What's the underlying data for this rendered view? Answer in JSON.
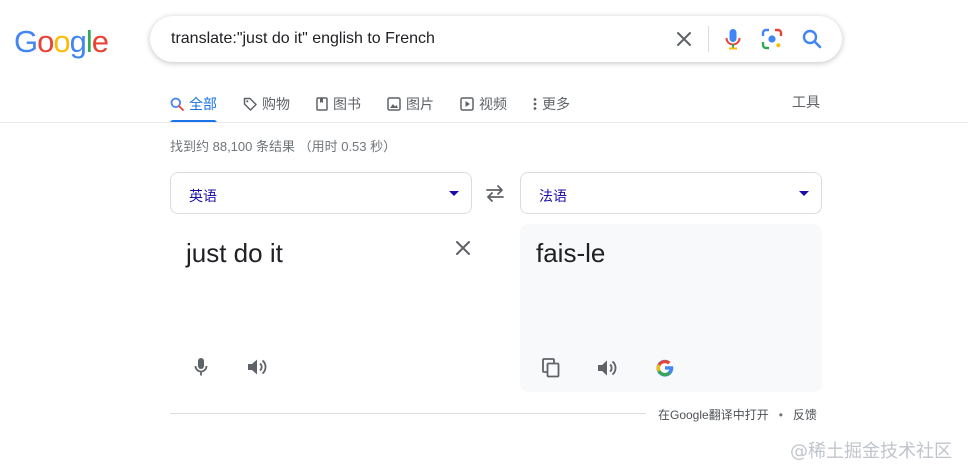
{
  "logo": {
    "letters": [
      "G",
      "o",
      "o",
      "g",
      "l",
      "e"
    ],
    "colors": [
      "#4285f4",
      "#ea4335",
      "#fbbc05",
      "#4285f4",
      "#34a853",
      "#ea4335"
    ]
  },
  "search": {
    "query": "translate:\"just do it\" english to French"
  },
  "tabs": [
    {
      "label": "全部",
      "icon": "search-icon",
      "active": true
    },
    {
      "label": "购物",
      "icon": "tag-icon"
    },
    {
      "label": "图书",
      "icon": "book-icon"
    },
    {
      "label": "图片",
      "icon": "image-icon"
    },
    {
      "label": "视频",
      "icon": "play-icon"
    },
    {
      "label": "更多",
      "icon": "more-vert-icon"
    }
  ],
  "tools_label": "工具",
  "result_stats": "找到约 88,100 条结果 （用时 0.53 秒）",
  "translate": {
    "source_lang": "英语",
    "target_lang": "法语",
    "source_text": "just do it",
    "target_text": "fais-le"
  },
  "footer": {
    "open_link": "在Google翻译中打开",
    "feedback": "反馈"
  },
  "watermark": "@稀土掘金技术社区",
  "colors": {
    "accent": "#1a73e8",
    "link": "#1a0dab",
    "text": "#202124",
    "muted": "#70757a"
  }
}
